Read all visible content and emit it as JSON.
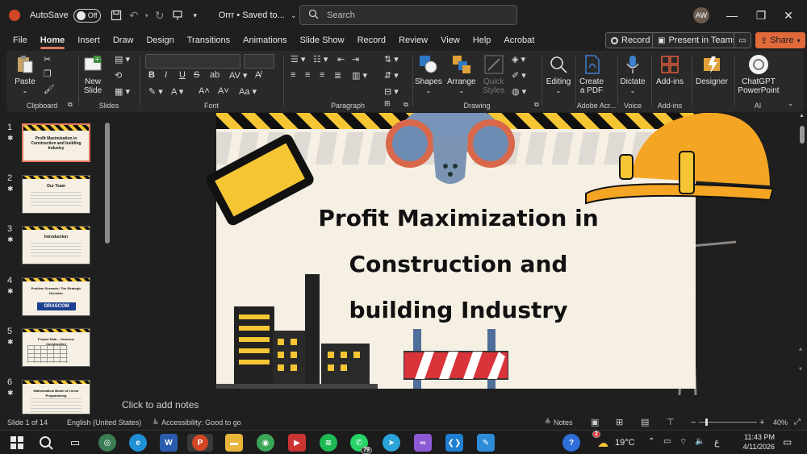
{
  "titlebar": {
    "autosave_label": "AutoSave",
    "autosave_state": "Off",
    "file_title": "Orrr • Saved to...",
    "search_placeholder": "Search",
    "user_initials": "AW"
  },
  "tabs": [
    "File",
    "Home",
    "Insert",
    "Draw",
    "Design",
    "Transitions",
    "Animations",
    "Slide Show",
    "Record",
    "Review",
    "View",
    "Help",
    "Acrobat"
  ],
  "active_tab": "Home",
  "tab_actions": {
    "record": "Record",
    "present_teams": "Present in Teams",
    "share": "Share"
  },
  "ribbon": {
    "paste": "Paste",
    "new_slide_1": "New",
    "new_slide_2": "Slide",
    "shapes": "Shapes",
    "arrange": "Arrange",
    "quick_styles_1": "Quick",
    "quick_styles_2": "Styles",
    "editing": "Editing",
    "create_pdf_1": "Create",
    "create_pdf_2": "a PDF",
    "dictate": "Dictate",
    "addins": "Add-ins",
    "designer": "Designer",
    "chatgpt_1": "ChatGPT",
    "chatgpt_2": "PowerPoint",
    "groups": {
      "clipboard": "Clipboard",
      "slides": "Slides",
      "font": "Font",
      "paragraph": "Paragraph",
      "drawing": "Drawing",
      "adobe": "Adobe Acr...",
      "voice": "Voice",
      "addins": "Add-ins",
      "ai": "AI"
    }
  },
  "thumbnails": [
    {
      "num": "1",
      "title": "Profit Maximization in Construction and building Industry"
    },
    {
      "num": "2",
      "title": "Our Team"
    },
    {
      "num": "3",
      "title": "Introduction"
    },
    {
      "num": "4",
      "title": "Problem Scenario: The Strategic Decision",
      "logo": "ORASCOM"
    },
    {
      "num": "5",
      "title": "Project Data – Orascom Construction"
    },
    {
      "num": "6",
      "title": "Mathematical Model of Linear Programming"
    }
  ],
  "slide": {
    "title_line1": "Profit Maximization in",
    "title_line2": "Construction and",
    "title_line3": "building Industry"
  },
  "notes_placeholder": "Click to add notes",
  "status": {
    "slide_info": "Slide 1 of 14",
    "language": "English (United States)",
    "accessibility": "Accessibility: Good to go",
    "notes": "Notes",
    "zoom": "40%"
  },
  "taskbar": {
    "weather": "19°C",
    "lang": "ع",
    "time": "11:43 PM",
    "date": "4/11/2026",
    "whatsapp_badge": "79",
    "weather_badge": "2"
  }
}
